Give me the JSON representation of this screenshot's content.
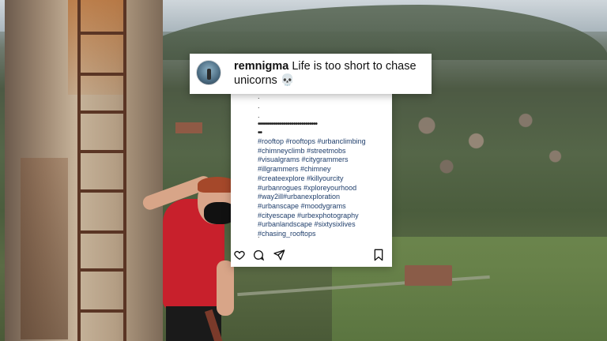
{
  "post": {
    "username": "remnigma",
    "caption": "Life is too short to chase unicorns",
    "caption_emoji": "💀",
    "dots": [
      ".",
      ".",
      "."
    ],
    "dot_line": "••••••••••••••••••••••••••••••",
    "dot_line2": "••",
    "hashtags": [
      "#rooftop #rooftops #urbanclimbing",
      "#chimneyclimb #streetmobs",
      "#visualgrams #citygrammers",
      "#illgrammers #chimney",
      "#createexplore #killyourcity",
      "#urbanrogues #xploreyourhood",
      "#way2ill#urbanexploration",
      "#urbanscape #moodygrams",
      "#cityescape #urbexphotography",
      "#urbanlandscape #sixtysixlives",
      "#chasing_rooftops"
    ],
    "trailing": "."
  },
  "actions": {
    "like_icon": "heart-icon",
    "comment_icon": "comment-icon",
    "share_icon": "send-icon",
    "save_icon": "bookmark-icon"
  },
  "colors": {
    "hashtag": "#1f3e6b",
    "shirt": "#c8202c"
  }
}
